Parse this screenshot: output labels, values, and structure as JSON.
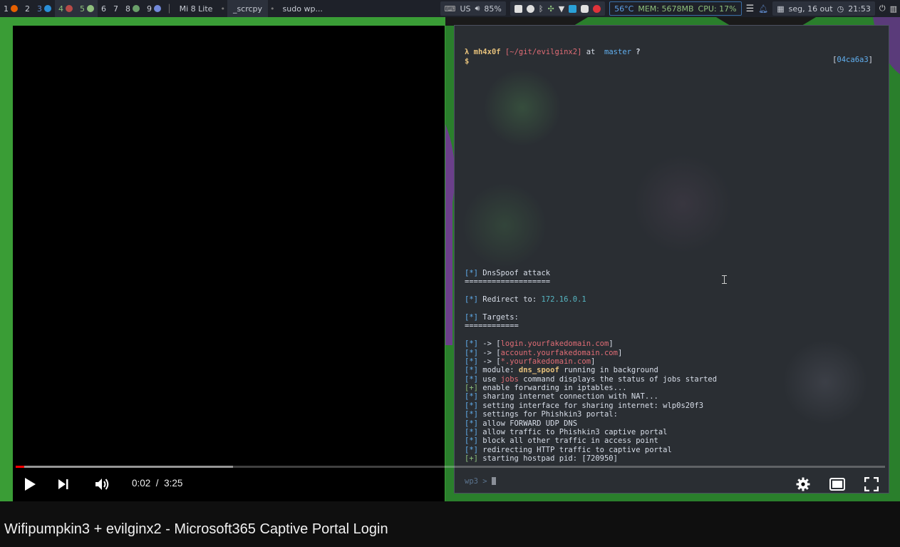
{
  "topbar": {
    "workspaces": [
      {
        "num": "1",
        "icon": "firefox-icon",
        "color": "#e66000"
      },
      {
        "num": "2",
        "icon": "",
        "color": ""
      },
      {
        "num": "3",
        "icon": "vscode-icon",
        "color": "#2a8fd8"
      },
      {
        "num": "4",
        "icon": "terminal-icon",
        "color": "#b94a48"
      },
      {
        "num": "5",
        "icon": "terminal-icon",
        "color": "#8ec07c"
      },
      {
        "num": "6",
        "icon": "",
        "color": ""
      },
      {
        "num": "7",
        "icon": "",
        "color": ""
      },
      {
        "num": "8",
        "icon": "app-icon",
        "color": "#6aa06a"
      },
      {
        "num": "9",
        "icon": "discord-icon",
        "color": "#7289da"
      }
    ],
    "windows": [
      "Mi 8 Lite",
      "_scrcpy",
      "sudo wp..."
    ],
    "keyboard_layout": "US",
    "volume": "85%",
    "temperature": "56°C",
    "memory": "MEM: 5678MB",
    "cpu": "CPU: 17%",
    "date": "seg, 16 out",
    "time": "21:53"
  },
  "terminal": {
    "prompt": {
      "lambda": "λ",
      "user": "mh4x0f",
      "path": "[~/git/evilginx2]",
      "at": "at",
      "branch": "master",
      "status": "?",
      "dollar": "$"
    },
    "commit_hash": "04ca6a3",
    "log": [
      {
        "tag": "[*]",
        "text": "DnsSpoof attack"
      },
      {
        "raw": "==================="
      },
      {
        "blank": true
      },
      {
        "tag": "[*]",
        "text": "Redirect to: ",
        "hl": "172.16.0.1",
        "hl_class": "cyan"
      },
      {
        "blank": true
      },
      {
        "tag": "[*]",
        "text": "Targets:"
      },
      {
        "raw": "============"
      },
      {
        "blank": true
      },
      {
        "tag": "[*]",
        "text": "-> [",
        "hl": "login.yourfakedomain.com",
        "hl_class": "red",
        "after": "]"
      },
      {
        "tag": "[*]",
        "text": "-> [",
        "hl": "account.yourfakedomain.com",
        "hl_class": "red",
        "after": "]"
      },
      {
        "tag": "[*]",
        "text": "-> [",
        "hl": "*.yourfakedomain.com",
        "hl_class": "red",
        "after": "]"
      },
      {
        "tag": "[*]",
        "text": "module: ",
        "hl": "dns_spoof",
        "hl_class": "yellow",
        "after": " running in background"
      },
      {
        "tag": "[*]",
        "text": "use ",
        "hl": "jobs",
        "hl_class": "red",
        "after": " command displays the status of jobs started"
      },
      {
        "tag": "[+]",
        "text": "enable forwarding in iptables..."
      },
      {
        "tag": "[*]",
        "text": "sharing internet connection with NAT..."
      },
      {
        "tag": "[*]",
        "text": "setting interface for sharing internet: wlp0s20f3"
      },
      {
        "tag": "[*]",
        "text": "settings for Phishkin3 portal:"
      },
      {
        "tag": "[*]",
        "text": "allow FORWARD UDP DNS"
      },
      {
        "tag": "[*]",
        "text": "allow traffic to Phishkin3 captive portal"
      },
      {
        "tag": "[*]",
        "text": "block all other traffic in access point"
      },
      {
        "tag": "[*]",
        "text": "redirecting HTTP traffic to captive portal"
      },
      {
        "tag": "[+]",
        "text": "starting hostpad pid: [720950]"
      }
    ],
    "repl_prompt": "wp3 > "
  },
  "player": {
    "current_time": "0:02",
    "separator": "/",
    "duration": "3:25",
    "played_fraction": 0.01,
    "buffered_fraction": 0.25
  },
  "video_title": "Wifipumpkin3 + evilginx2 - Microsoft365 Captive Portal Login",
  "colors": {
    "progress_played": "#ff0000",
    "wallpaper_green": "#3a9d36",
    "terminal_bg": "#2a2e33"
  }
}
